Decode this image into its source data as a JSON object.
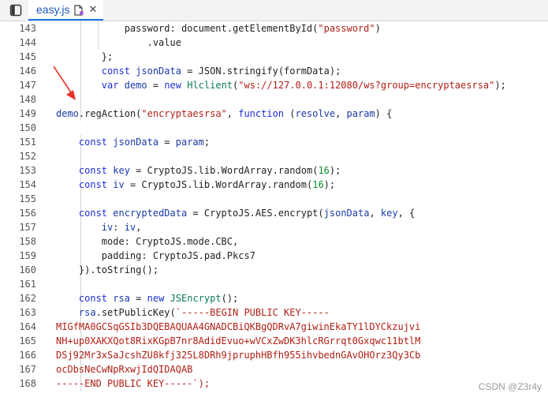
{
  "tab": {
    "label": "easy.js"
  },
  "watermark": "CSDN @Z3r4y",
  "lines": [
    {
      "n": "143",
      "t": "            password: document.getElementById(\"password\")"
    },
    {
      "n": "144",
      "t": "                .value"
    },
    {
      "n": "145",
      "t": "        };"
    },
    {
      "n": "146",
      "t": "        const jsonData = JSON.stringify(formData);"
    },
    {
      "n": "147",
      "t": "        var demo = new Hlclient(\"ws://127.0.0.1:12080/ws?group=encryptaesrsa\");"
    },
    {
      "n": "148",
      "t": ""
    },
    {
      "n": "149",
      "t": "demo.regAction(\"encryptaesrsa\", function (resolve, param) {"
    },
    {
      "n": "150",
      "t": ""
    },
    {
      "n": "151",
      "t": "    const jsonData = param;"
    },
    {
      "n": "152",
      "t": ""
    },
    {
      "n": "153",
      "t": "    const key = CryptoJS.lib.WordArray.random(16);"
    },
    {
      "n": "154",
      "t": "    const iv = CryptoJS.lib.WordArray.random(16);"
    },
    {
      "n": "155",
      "t": ""
    },
    {
      "n": "156",
      "t": "    const encryptedData = CryptoJS.AES.encrypt(jsonData, key, {"
    },
    {
      "n": "157",
      "t": "        iv: iv,"
    },
    {
      "n": "158",
      "t": "        mode: CryptoJS.mode.CBC,"
    },
    {
      "n": "159",
      "t": "        padding: CryptoJS.pad.Pkcs7"
    },
    {
      "n": "160",
      "t": "    }).toString();"
    },
    {
      "n": "161",
      "t": ""
    },
    {
      "n": "162",
      "t": "    const rsa = new JSEncrypt();"
    },
    {
      "n": "163",
      "t": "    rsa.setPublicKey(`-----BEGIN PUBLIC KEY-----"
    },
    {
      "n": "164",
      "t": "MIGfMA0GCSqGSIb3DQEBAQUAA4GNADCBiQKBgQDRvA7giwinEkaTY1lDYCkzujvi"
    },
    {
      "n": "165",
      "t": "NH+up0XAKXQot8RixKGpB7nr8AdidEvuo+wVCxZwDK3hlcRGrrqt0Gxqwc11btlM"
    },
    {
      "n": "166",
      "t": "DSj92Mr3xSaJcshZU8kfj325L8DRh9jpruphHBfh955ihvbednGAvOHOrz3Qy3Cb"
    },
    {
      "n": "167",
      "t": "ocDbsNeCwNpRxwjIdQIDAQAB"
    },
    {
      "n": "168",
      "t": "-----END PUBLIC KEY-----`);"
    }
  ]
}
